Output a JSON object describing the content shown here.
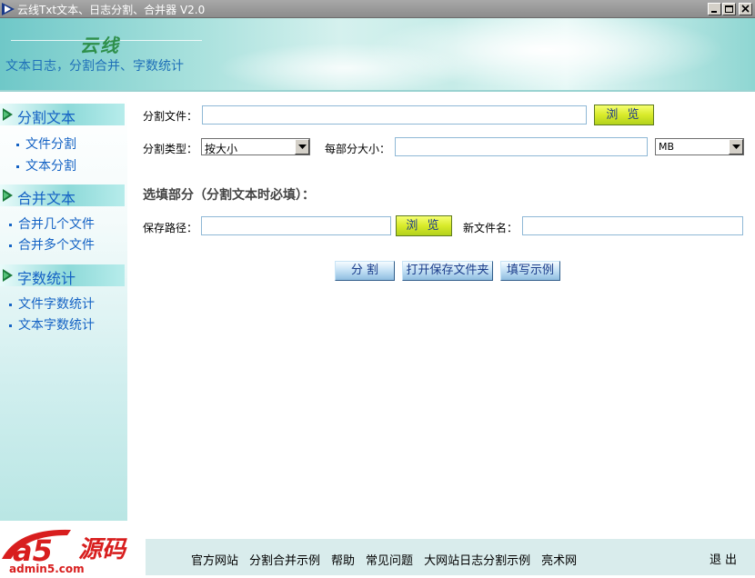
{
  "window": {
    "title": "云线Txt文本、日志分割、合并器 V2.0"
  },
  "banner": {
    "brand": "云线",
    "subtitle": "文本日志，分割合并、字数统计"
  },
  "sidebar": {
    "sections": [
      {
        "title": "分割文本",
        "items": [
          "文件分割",
          "文本分割"
        ]
      },
      {
        "title": "合并文本",
        "items": [
          "合并几个文件",
          "合并多个文件"
        ]
      },
      {
        "title": "字数统计",
        "items": [
          "文件字数统计",
          "文本字数统计"
        ]
      }
    ]
  },
  "form": {
    "split_file_label": "分割文件：",
    "split_file_value": "",
    "browse_label": "浏 览",
    "split_type_label": "分割类型：",
    "split_type_value": "按大小",
    "part_size_label": "每部分大小：",
    "part_size_value": "",
    "unit_value": "MB",
    "optional_title": "选填部分（分割文本时必填）：",
    "save_path_label": "保存路径：",
    "save_path_value": "",
    "new_name_label": "新文件名：",
    "new_name_value": ""
  },
  "actions": {
    "split": "分 割",
    "open_folder": "打开保存文件夹",
    "example": "填写示例"
  },
  "footer": {
    "links": [
      "官方网站",
      "分割合并示例",
      "帮助",
      "常见问题",
      "大网站日志分割示例",
      "亮术网"
    ],
    "exit": "退出"
  },
  "logo": {
    "text_main": "源码",
    "text_url": "admin5.com",
    "mark": "a5"
  },
  "colors": {
    "accent_blue": "#1462c4",
    "browse_yellow": "#d8ea2a",
    "banner_teal": "#8ed6d2"
  }
}
